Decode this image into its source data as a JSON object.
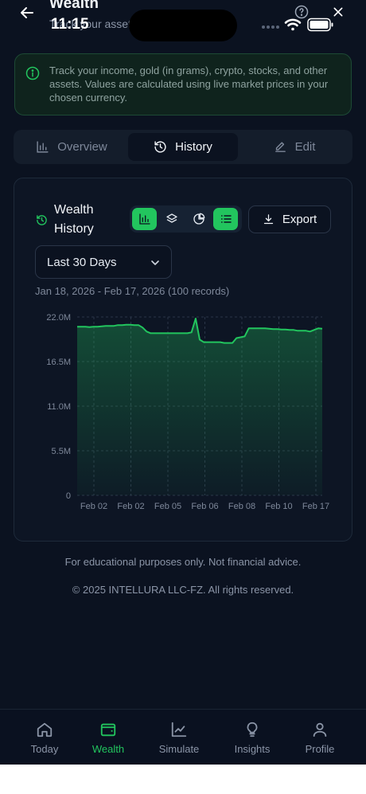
{
  "header": {
    "title": "Wealth",
    "subtitle": "Track your assets",
    "time": "11:15"
  },
  "info": {
    "text": "Track your income, gold (in grams), crypto, stocks, and other assets. Values are calculated using live market prices in your chosen currency."
  },
  "tabs": [
    {
      "label": "Overview",
      "icon": "bar-chart-icon",
      "active": false
    },
    {
      "label": "History",
      "icon": "history-icon",
      "active": true
    },
    {
      "label": "Edit",
      "icon": "pencil-icon",
      "active": false
    }
  ],
  "card": {
    "title": "Wealth History",
    "view_buttons": [
      {
        "icon": "bar-chart-icon",
        "active": true
      },
      {
        "icon": "layers-icon",
        "active": false
      },
      {
        "icon": "pie-chart-icon",
        "active": false
      },
      {
        "icon": "list-icon",
        "active": true
      }
    ],
    "export_label": "Export",
    "period_selected": "Last 30 Days",
    "range_text": "Jan 18, 2026 - Feb 17, 2026 (100 records)"
  },
  "chart_data": {
    "type": "area",
    "title": "",
    "xlabel": "",
    "ylabel": "",
    "ylim": [
      0,
      22000000
    ],
    "y_ticks": [
      "22.0M",
      "16.5M",
      "11.0M",
      "5.5M",
      "0"
    ],
    "x_ticks": [
      "Feb 02",
      "Feb 02",
      "Feb 05",
      "Feb 06",
      "Feb 08",
      "Feb 10",
      "Feb 17"
    ],
    "grid": true,
    "colors": {
      "line": "#22c55e",
      "fill": "#22c55e"
    },
    "values": [
      20.8,
      20.8,
      20.8,
      20.75,
      20.8,
      20.8,
      20.85,
      20.9,
      20.9,
      20.9,
      21.0,
      21.0,
      21.05,
      21.05,
      21.0,
      21.0,
      20.7,
      20.2,
      20.0,
      20.0,
      20.0,
      20.0,
      20.0,
      20.0,
      20.0,
      20.0,
      20.0,
      20.0,
      20.1,
      21.8,
      19.2,
      18.9,
      18.9,
      18.9,
      18.9,
      18.9,
      18.8,
      18.8,
      18.8,
      19.4,
      19.5,
      19.6,
      20.6,
      20.6,
      20.6,
      20.6,
      20.6,
      20.55,
      20.5,
      20.5,
      20.45,
      20.45,
      20.4,
      20.4,
      20.3,
      20.3,
      20.3,
      20.2,
      20.4,
      20.6,
      20.55
    ],
    "values_unit": "M"
  },
  "footer": {
    "disclaimer": "For educational purposes only. Not financial advice.",
    "copyright": "© 2025 INTELLURA LLC-FZ. All rights reserved."
  },
  "nav": [
    {
      "label": "Today",
      "icon": "home-icon",
      "active": false
    },
    {
      "label": "Wealth",
      "icon": "wallet-icon",
      "active": true
    },
    {
      "label": "Simulate",
      "icon": "line-chart-icon",
      "active": false
    },
    {
      "label": "Insights",
      "icon": "lightbulb-icon",
      "active": false
    },
    {
      "label": "Profile",
      "icon": "user-icon",
      "active": false
    }
  ]
}
